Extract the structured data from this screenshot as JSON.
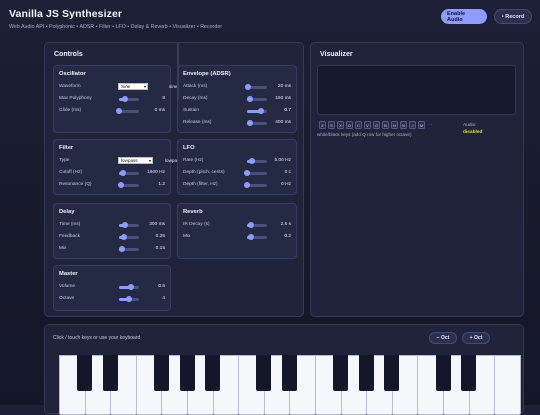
{
  "app": {
    "title": "Vanilla JS Synthesizer",
    "subtitle": "Web Audio API • Polyphonic • ADSR • Filter • LFO • Delay & Reverb • Visualizer • Recorder",
    "enable_audio_label": "Enable Audio",
    "record_label": "• Record",
    "accent_color": "#8e9bff"
  },
  "controls": {
    "title": "Controls",
    "oscillator": {
      "title": "Oscillator",
      "waveform_label": "Waveform",
      "waveform_value": "Sine",
      "waveform_display": "sine",
      "polyphony_label": "Max Polyphony",
      "polyphony_value": "8",
      "polyphony_level": 0.3,
      "glide_label": "Glide (ms)",
      "glide_value": "0 ms",
      "glide_level": 0.0
    },
    "envelope": {
      "title": "Envelope (ADSR)",
      "attack_label": "Attack (ms)",
      "attack_value": "20 ms",
      "attack_level": 0.05,
      "decay_label": "Decay (ms)",
      "decay_value": "150 ms",
      "decay_level": 0.15,
      "sustain_label": "Sustain",
      "sustain_value": "0.7",
      "sustain_level": 0.7,
      "release_label": "Release (ms)",
      "release_value": "400 ms",
      "release_level": 0.15
    },
    "filter": {
      "title": "Filter",
      "type_label": "Type",
      "type_value": "lowpass",
      "type_display": "lowpass",
      "cutoff_label": "Cutoff (Hz)",
      "cutoff_value": "1600 Hz",
      "cutoff_level": 0.2,
      "resonance_label": "Resonance (Q)",
      "resonance_value": "1.2",
      "resonance_level": 0.1
    },
    "lfo": {
      "title": "LFO",
      "rate_label": "Rate (Hz)",
      "rate_value": "5.00 Hz",
      "rate_level": 0.25,
      "depth_pitch_label": "Depth (pitch, cents)",
      "depth_pitch_value": "0 c",
      "depth_pitch_level": 0.0,
      "depth_filter_label": "Depth (filter, Hz)",
      "depth_filter_value": "0 Hz",
      "depth_filter_level": 0.0
    },
    "delay": {
      "title": "Delay",
      "time_label": "Time (ms)",
      "time_value": "300 ms",
      "time_level": 0.3,
      "feedback_label": "Feedback",
      "feedback_value": "0.25",
      "feedback_level": 0.25,
      "mix_label": "Mix",
      "mix_value": "0.15",
      "mix_level": 0.15
    },
    "reverb": {
      "title": "Reverb",
      "ir_label": "IR Decay (s)",
      "ir_value": "2.5 s",
      "ir_level": 0.2,
      "mix_label": "Mix",
      "mix_value": "0.2",
      "mix_level": 0.2
    },
    "master": {
      "title": "Master",
      "volume_label": "Volume",
      "volume_value": "0.6",
      "volume_level": 0.6,
      "octave_label": "Octave",
      "octave_value": "4",
      "octave_level": 0.5
    }
  },
  "visualizer": {
    "title": "Visualizer",
    "keys": [
      "Z",
      "S",
      "X",
      "D",
      "C",
      "V",
      "G",
      "B",
      "H",
      "N",
      "J",
      "M"
    ],
    "hint": "white/black keys (add Q row for higher octave)",
    "audio_label": "Audio:",
    "audio_status": "disabled",
    "audio_status_color": "#f1d46c"
  },
  "keyboard": {
    "hint": "Click / touch keys or use your keyboard",
    "oct_down_label": "− Oct",
    "oct_up_label": "+ Oct"
  }
}
